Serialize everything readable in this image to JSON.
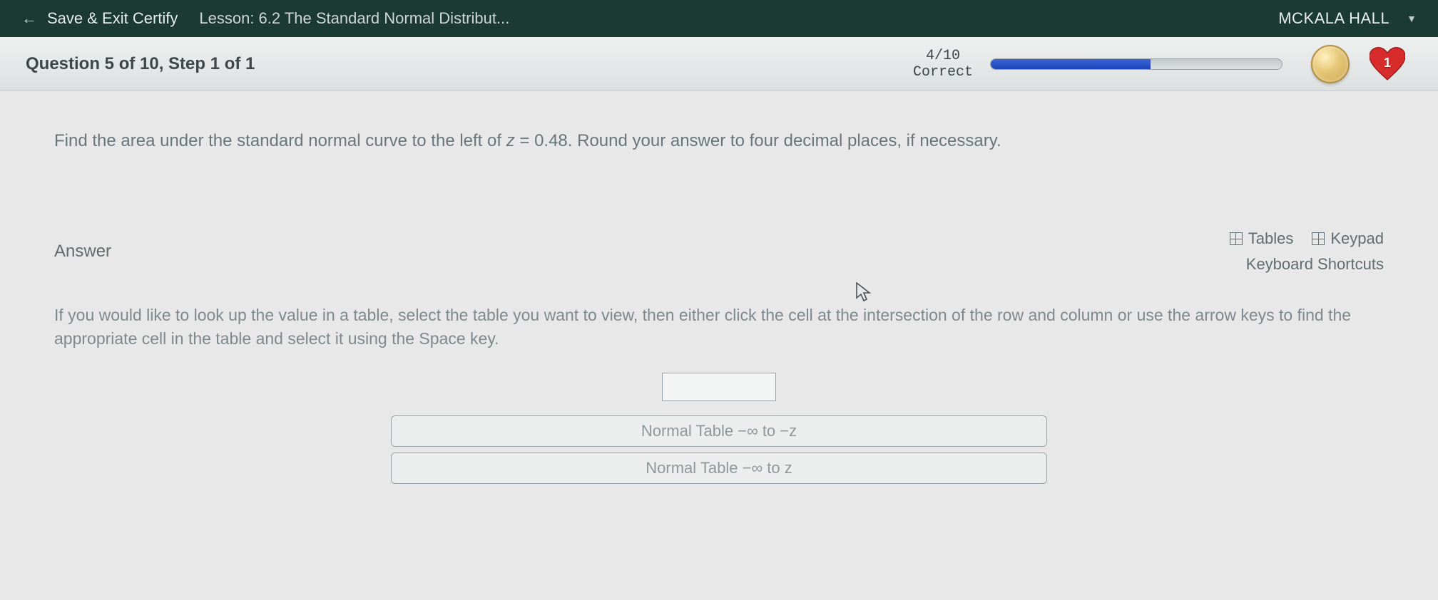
{
  "header": {
    "save_exit": "Save & Exit Certify",
    "lesson": "Lesson: 6.2 The Standard Normal Distribut...",
    "user": "MCKALA HALL"
  },
  "status": {
    "question_label": "Question 5 of 10, Step 1 of 1",
    "score": "4/10",
    "score_label": "Correct",
    "progress_pct": 55,
    "lives": "1"
  },
  "question": {
    "prefix": "Find the area under the standard normal curve to the left of ",
    "var": "z",
    "eq": " = ",
    "value": "0.48",
    "suffix": ".  Round your answer to four decimal places, if necessary."
  },
  "answer": {
    "label": "Answer",
    "tables_btn": "Tables",
    "keypad_btn": "Keypad",
    "kb_shortcuts": "Keyboard Shortcuts",
    "instructions": "If you would like to look up the value in a table, select the table you want to view, then either click the cell at the intersection of the row and column or use the arrow keys to find the appropriate cell in the table and select it using the Space key.",
    "input_value": "",
    "table_neg": "Normal Table −∞ to −z",
    "table_pos": "Normal Table −∞ to z"
  }
}
